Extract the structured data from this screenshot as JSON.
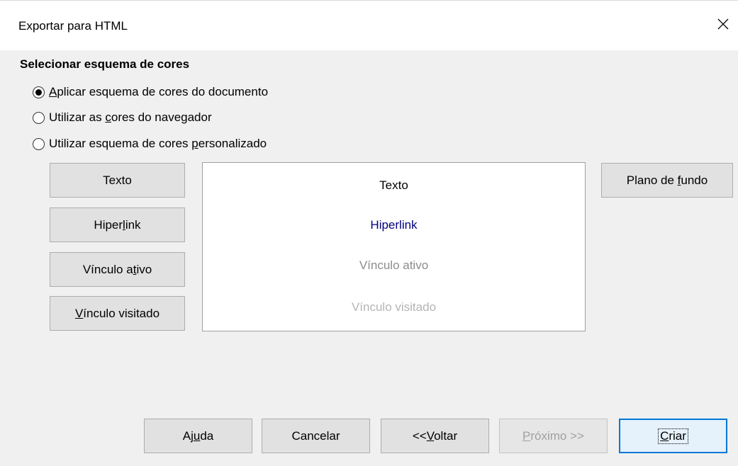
{
  "window": {
    "title": "Exportar para HTML",
    "close_icon": "close-icon"
  },
  "color_scheme": {
    "section_title": "Selecionar esquema de cores",
    "options": [
      {
        "pre": "",
        "key": "A",
        "post": "plicar esquema de cores do documento",
        "selected": true
      },
      {
        "pre": "Utilizar as ",
        "key": "c",
        "post": "ores do navegador",
        "selected": false
      },
      {
        "pre": "Utilizar esquema de cores ",
        "key": "p",
        "post": "ersonalizado",
        "selected": false
      }
    ]
  },
  "color_buttons": {
    "text": "Texto",
    "hyperlink": {
      "pre": "Hiper",
      "key": "l",
      "post": "ink"
    },
    "active_link": {
      "pre": "Vínculo a",
      "key": "t",
      "post": "ivo"
    },
    "visited_link": {
      "pre": "",
      "key": "V",
      "post": "ínculo visitado"
    },
    "background": {
      "pre": "Plano de ",
      "key": "f",
      "post": "undo"
    }
  },
  "preview": {
    "text": "Texto",
    "hyperlink": "Hiperlink",
    "active_link": "Vínculo ativo",
    "visited_link": "Vínculo visitado",
    "colors": {
      "text": "#000000",
      "hyperlink": "#000080",
      "active_link": "#8c8c8c",
      "visited_link": "#b4b4b4"
    }
  },
  "footer": {
    "help": {
      "pre": "Aj",
      "key": "u",
      "post": "da"
    },
    "cancel": "Cancelar",
    "back": {
      "pre": "<<",
      "key": "V",
      "post": "oltar"
    },
    "next": {
      "pre": "",
      "key": "P",
      "post": "róximo >>"
    },
    "create": {
      "pre": "",
      "key": "C",
      "post": "riar"
    }
  }
}
